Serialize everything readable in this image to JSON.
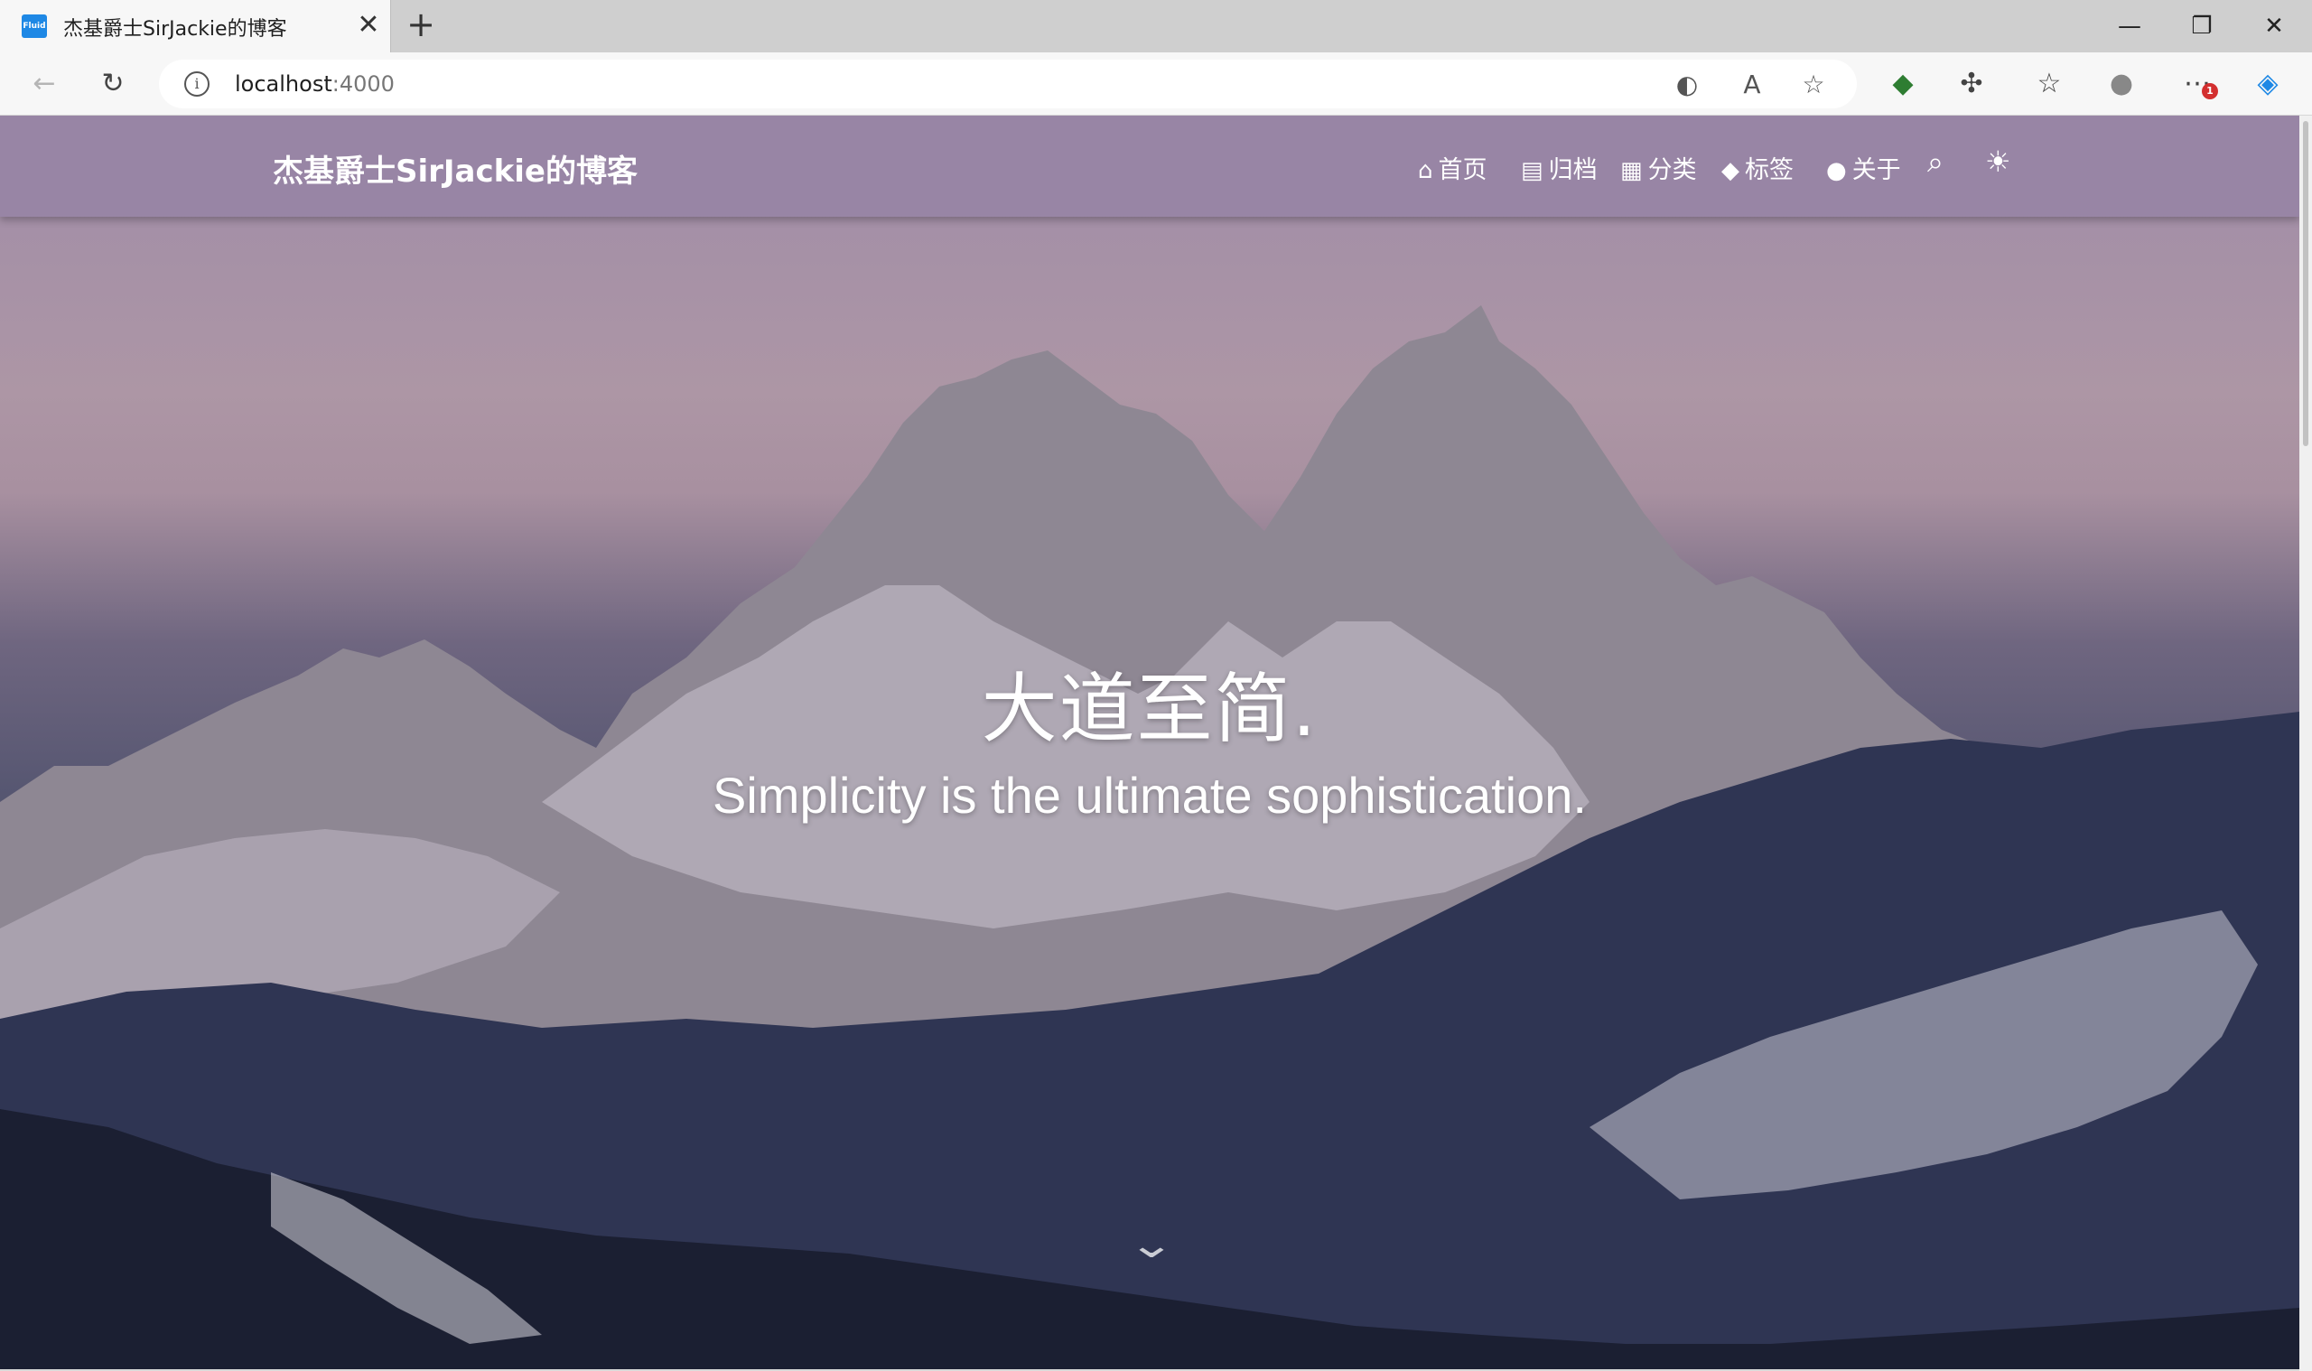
{
  "browser": {
    "tab": {
      "favicon_text": "Fluid",
      "title": "杰基爵士SirJackie的博客",
      "close": "✕"
    },
    "new_tab": "+",
    "window": {
      "minimize": "—",
      "restore": "❐",
      "close": "✕"
    },
    "address": {
      "host": "localhost",
      "port": ":4000"
    },
    "extension_badge": "1"
  },
  "site": {
    "brand": "杰基爵士SirJackie的博客",
    "nav": [
      {
        "icon": "home-icon",
        "glyph": "⌂",
        "label": "首页"
      },
      {
        "icon": "archive-icon",
        "glyph": "▤",
        "label": "归档"
      },
      {
        "icon": "category-icon",
        "glyph": "▦",
        "label": "分类"
      },
      {
        "icon": "tags-icon",
        "glyph": "◆",
        "label": "标签"
      },
      {
        "icon": "user-icon",
        "glyph": "●",
        "label": "关于"
      }
    ],
    "search_glyph": "⌕",
    "theme_glyph": "☀",
    "hero_title": "大道至简.",
    "hero_subtitle": "Simplicity is the ultimate sophistication.",
    "scroll_down_glyph": "⌄"
  },
  "colors": {
    "navbar": "#9684a5",
    "sky_top": "#9f8ca8",
    "forest": "#1c2035"
  }
}
